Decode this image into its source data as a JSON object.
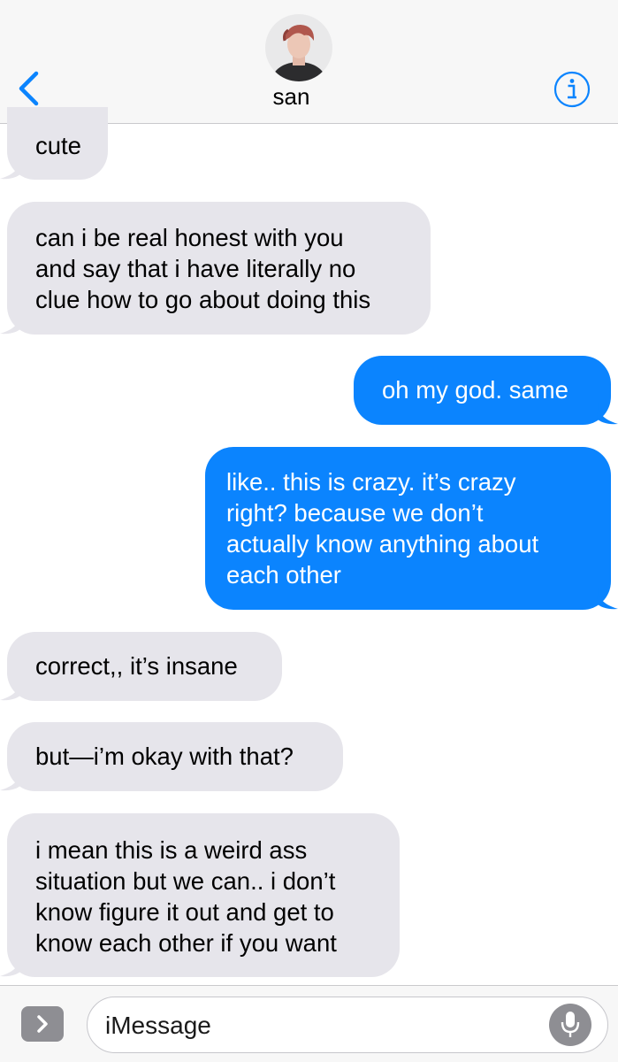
{
  "header": {
    "contact_name": "san",
    "back_icon": "chevron-left-icon",
    "info_icon": "info-icon",
    "accent_color": "#0b84fe"
  },
  "messages": [
    {
      "direction": "received",
      "text": "cute"
    },
    {
      "direction": "received",
      "text": "can i be real honest with you\nand say that i have literally no\nclue how to go about doing this"
    },
    {
      "direction": "sent",
      "text": "oh my god. same"
    },
    {
      "direction": "sent",
      "text": "like.. this is crazy. it’s crazy\nright? because we don’t\nactually know anything about\neach other"
    },
    {
      "direction": "received",
      "text": "correct,, it’s insane"
    },
    {
      "direction": "received",
      "text": "but—i’m okay with that?"
    },
    {
      "direction": "received",
      "text": "i mean this is a weird ass\nsituation but we can.. i don’t\nknow figure it out and get to\nknow each other if you want"
    }
  ],
  "colors": {
    "received_bubble": "#e6e5eb",
    "sent_bubble": "#0b84fe"
  },
  "input_bar": {
    "placeholder": "iMessage",
    "value": "",
    "apps_icon": "chevron-right-icon",
    "mic_icon": "microphone-icon"
  }
}
